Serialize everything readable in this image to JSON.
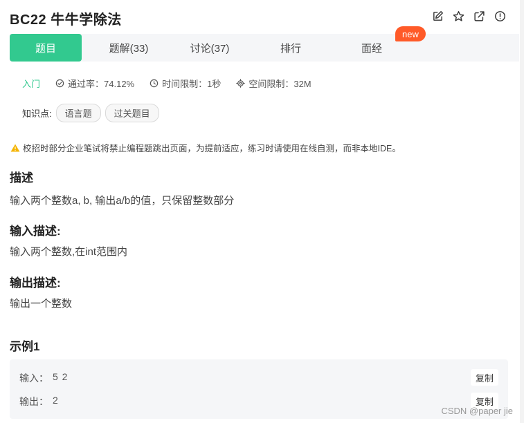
{
  "problem": {
    "title": "BC22  牛牛学除法"
  },
  "header_icons": [
    "edit-icon",
    "star-icon",
    "share-icon",
    "report-icon"
  ],
  "tabs": [
    {
      "label": "题目",
      "active": true
    },
    {
      "label": "题解(33)"
    },
    {
      "label": "讨论(37)"
    },
    {
      "label": "排行"
    },
    {
      "label": "面经"
    }
  ],
  "badge": "new",
  "meta": {
    "level": "入门",
    "pass_rate": "通过率：74.12%",
    "time_limit": "时间限制：1秒",
    "space_limit": "空间限制：32M"
  },
  "knowledge": {
    "label": "知识点:",
    "tags": [
      "语言题",
      "过关题目"
    ]
  },
  "warning": "校招时部分企业笔试将禁止编程题跳出页面，为提前适应，练习时请使用在线自测，而非本地IDE。",
  "sections": {
    "desc_title": "描述",
    "desc_text": "输入两个整数a, b, 输出a/b的值，只保留整数部分",
    "input_title": "输入描述:",
    "input_text": "输入两个整数,在int范围内",
    "output_title": "输出描述:",
    "output_text": "输出一个整数"
  },
  "example": {
    "title": "示例1",
    "input_label": "输入：",
    "input_value": "5 2",
    "output_label": "输出：",
    "output_value": "2",
    "copy_label": "复制"
  },
  "watermark": "CSDN @paper jie",
  "colors": {
    "accent": "#32c98f",
    "badge": "#ff5a28",
    "warning": "#f5b400"
  }
}
